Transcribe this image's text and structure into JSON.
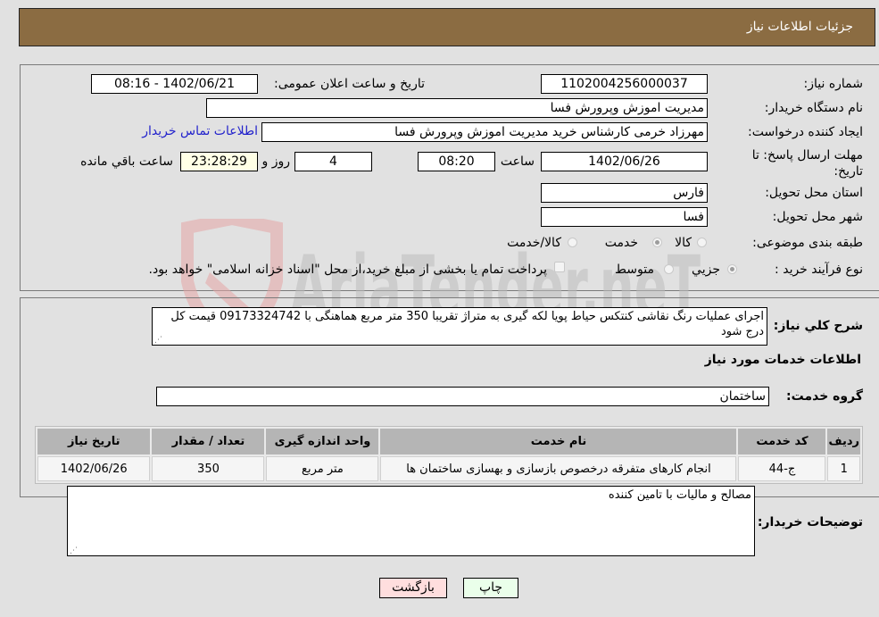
{
  "header": {
    "title": "جزئیات اطلاعات نیاز"
  },
  "form": {
    "need_number": {
      "label": "شماره نیاز:",
      "value": "1102004256000037"
    },
    "announce_datetime": {
      "label": "تاریخ و ساعت اعلان عمومی:",
      "value": "1402/06/21 - 08:16"
    },
    "buyer_org": {
      "label": "نام دستگاه خریدار:",
      "value": "مدیریت اموزش وپرورش فسا"
    },
    "requester": {
      "label": "ایجاد کننده درخواست:",
      "value": "مهرزاد خرمی کارشناس خرید مدیریت اموزش وپرورش فسا"
    },
    "buyer_contact_link": "اطلاعات تماس خریدار",
    "deadline": {
      "label": "مهلت ارسال پاسخ: تا تاریخ:",
      "date": "1402/06/26",
      "time_label": "ساعت",
      "time": "08:20",
      "days": "4",
      "days_label": "روز و",
      "remaining": "23:28:29",
      "remaining_label": "ساعت باقي مانده"
    },
    "province": {
      "label": "استان محل تحویل:",
      "value": "فارس"
    },
    "city": {
      "label": "شهر محل تحویل:",
      "value": "فسا"
    },
    "category": {
      "label": "طبقه بندی موضوعی:",
      "options": [
        "کالا",
        "خدمت",
        "کالا/خدمت"
      ],
      "selected": "خدمت"
    },
    "process_type": {
      "label": "نوع فرآیند خرید :",
      "options": [
        "جزيي",
        "متوسط"
      ],
      "selected": "جزيي",
      "treasury_note": "پرداخت تمام یا بخشی از مبلغ خرید،از محل \"اسناد خزانه اسلامی\" خواهد بود.",
      "treasury_checked": false
    }
  },
  "description": {
    "label": "شرح کلي نياز:",
    "value": "اجرای عملیات رنگ نقاشی کنتکس حیاط پویا لکه گیری به متراژ تقریبا 350 متر مربع هماهنگی با 09173324742 قیمت کل درج شود"
  },
  "services": {
    "section_title": "اطلاعات خدمات مورد نیاز",
    "group_label": "گروه خدمت:",
    "group_value": "ساختمان",
    "columns": [
      "ردیف",
      "کد خدمت",
      "نام خدمت",
      "واحد اندازه گیری",
      "تعداد / مقدار",
      "تاریخ نیاز"
    ],
    "rows": [
      [
        "1",
        "ج-44",
        "انجام کارهای متفرقه درخصوص بازسازی و بهسازی ساختمان ها",
        "متر مربع",
        "350",
        "1402/06/26"
      ]
    ]
  },
  "buyer_notes": {
    "label": "توضیحات خریدار:",
    "value": "مصالح و مالیات با تامین کننده"
  },
  "buttons": {
    "print": "چاپ",
    "back": "بازگشت"
  },
  "watermark": {
    "text": "AriaTender.neT"
  }
}
